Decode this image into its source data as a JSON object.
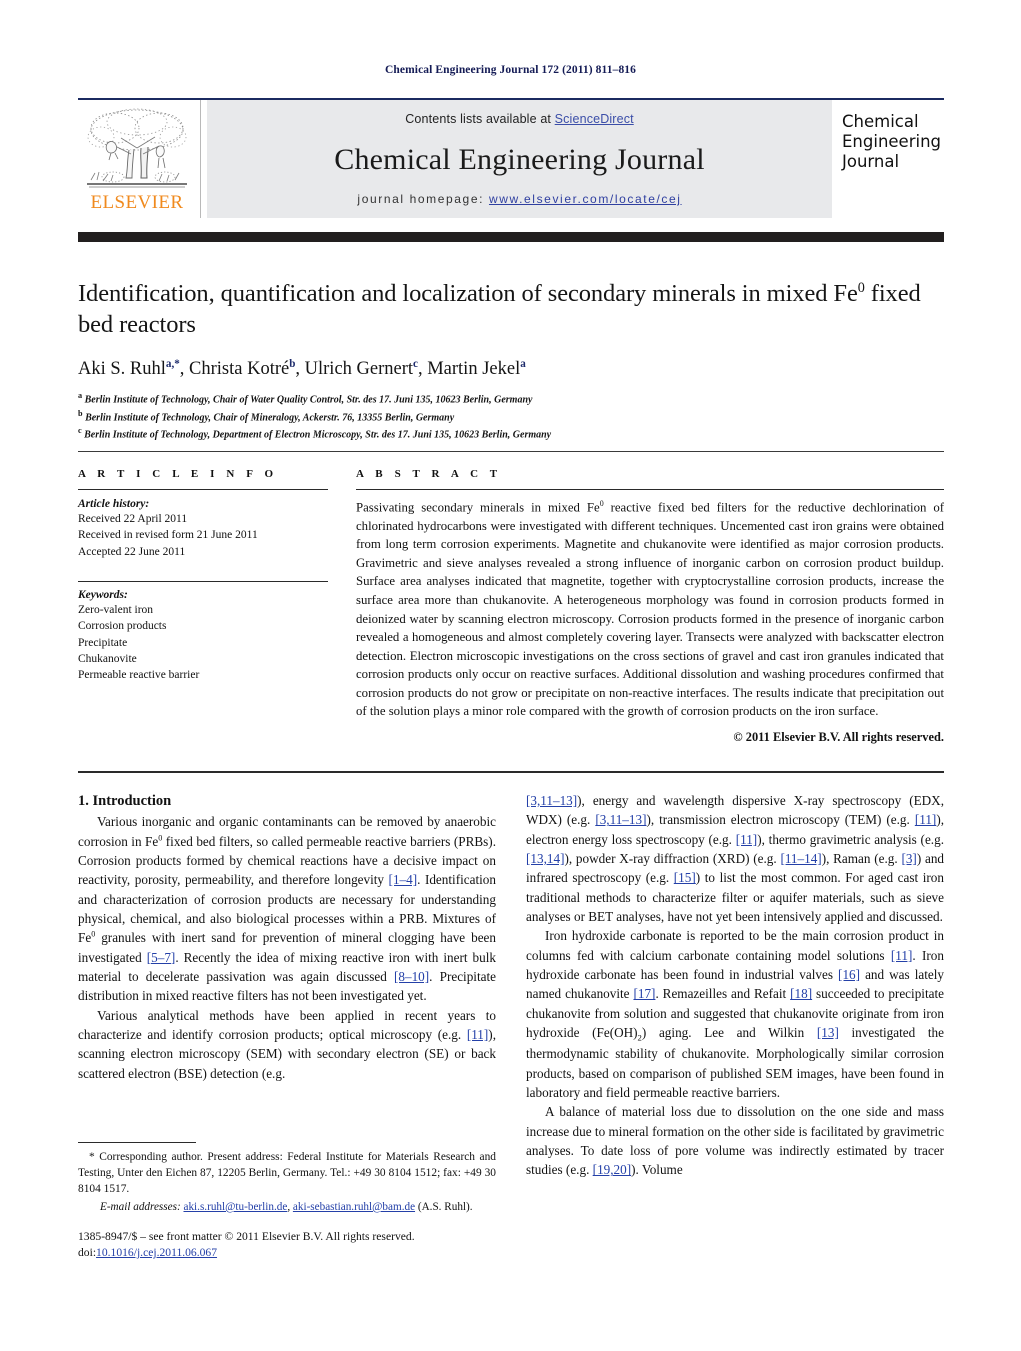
{
  "running_head": "Chemical Engineering Journal 172 (2011) 811–816",
  "masthead": {
    "contents_prefix": "Contents lists available at ",
    "sciencedirect": "ScienceDirect",
    "journal_title": "Chemical Engineering Journal",
    "homepage_label": "journal homepage: ",
    "homepage_url": "www.elsevier.com/locate/cej",
    "publisher_wordmark": "ELSEVIER",
    "cover_title": "Chemical Engineering Journal",
    "accent_orange": "#f08a1e",
    "link_blue": "#2f3fa0",
    "rule_navy": "#1b2a60"
  },
  "article": {
    "title_line1": "Identification, quantification and localization of secondary minerals in mixed Fe",
    "title_sup1": "0",
    "title_line2": "fixed bed reactors",
    "authors": [
      {
        "name": "Aki S. Ruhl",
        "marks": "a,*"
      },
      {
        "name": "Christa Kotré",
        "marks": "b"
      },
      {
        "name": "Ulrich Gernert",
        "marks": "c"
      },
      {
        "name": "Martin Jekel",
        "marks": "a"
      }
    ],
    "affiliations": [
      {
        "mark": "a",
        "text": "Berlin Institute of Technology, Chair of Water Quality Control, Str. des 17. Juni 135, 10623 Berlin, Germany"
      },
      {
        "mark": "b",
        "text": "Berlin Institute of Technology, Chair of Mineralogy, Ackerstr. 76, 13355 Berlin, Germany"
      },
      {
        "mark": "c",
        "text": "Berlin Institute of Technology, Department of Electron Microscopy, Str. des 17. Juni 135, 10623 Berlin, Germany"
      }
    ]
  },
  "article_info": {
    "heading": "A R T I C L E   I N F O",
    "history_label": "Article history:",
    "history": [
      "Received 22 April 2011",
      "Received in revised form 21 June 2011",
      "Accepted 22 June 2011"
    ],
    "keywords_label": "Keywords:",
    "keywords": [
      "Zero-valent iron",
      "Corrosion products",
      "Precipitate",
      "Chukanovite",
      "Permeable reactive barrier"
    ]
  },
  "abstract": {
    "heading": "A B S T R A C T",
    "part1": "Passivating secondary minerals in mixed Fe",
    "sup": "0",
    "part2": " reactive fixed bed filters for the reductive dechlorination of chlorinated hydrocarbons were investigated with different techniques. Uncemented cast iron grains were obtained from long term corrosion experiments. Magnetite and chukanovite were identified as major corrosion products. Gravimetric and sieve analyses revealed a strong influence of inorganic carbon on corrosion product buildup. Surface area analyses indicated that magnetite, together with cryptocrystalline corrosion products, increase the surface area more than chukanovite. A heterogeneous morphology was found in corrosion products formed in deionized water by scanning electron microscopy. Corrosion products formed in the presence of inorganic carbon revealed a homogeneous and almost completely covering layer. Transects were analyzed with backscatter electron detection. Electron microscopic investigations on the cross sections of gravel and cast iron granules indicated that corrosion products only occur on reactive surfaces. Additional dissolution and washing procedures confirmed that corrosion products do not grow or precipitate on non-reactive interfaces. The results indicate that precipitation out of the solution plays a minor role compared with the growth of corrosion products on the iron surface.",
    "copyright": "© 2011 Elsevier B.V. All rights reserved."
  },
  "introduction": {
    "heading": "1.  Introduction",
    "left": {
      "p1_a": "Various inorganic and organic contaminants can be removed by anaerobic corrosion in Fe",
      "p1_sup": "0",
      "p1_b": " fixed bed filters, so called permeable reactive barriers (PRBs). Corrosion products formed by chemical reactions have a decisive impact on reactivity, porosity, permeability, and therefore longevity ",
      "p1_ref1": "[1–4]",
      "p1_c": ". Identification and characterization of corrosion products are necessary for understanding physical, chemical, and also biological processes within a PRB. Mixtures of Fe",
      "p1_sup2": "0",
      "p1_d": " granules with inert sand for prevention of mineral clogging have been investigated ",
      "p1_ref2": "[5–7]",
      "p1_e": ". Recently the idea of mixing reactive iron with inert bulk material to decelerate passivation was again discussed ",
      "p1_ref3": "[8–10]",
      "p1_f": ". Precipitate distribution in mixed reactive filters has not been investigated yet.",
      "p2_a": "Various analytical methods have been applied in recent years to characterize and identify corrosion products; optical microscopy (e.g. ",
      "p2_ref1": "[11]",
      "p2_b": "), scanning electron microscopy (SEM) with secondary electron (SE) or back scattered electron (BSE) detection (e.g. "
    },
    "right": {
      "p2_ref2": "[3,11–13]",
      "p2_c": "), energy and wavelength dispersive X-ray spectroscopy (EDX, WDX) (e.g. ",
      "p2_ref3": "[3,11–13]",
      "p2_d": "), transmission electron microscopy (TEM) (e.g. ",
      "p2_ref4": "[11]",
      "p2_e": "), electron energy loss spectroscopy (e.g. ",
      "p2_ref5": "[11]",
      "p2_f": "), thermo gravimetric analysis (e.g. ",
      "p2_ref6": "[13,14]",
      "p2_g": "), powder X-ray diffraction (XRD) (e.g. ",
      "p2_ref7": "[11–14]",
      "p2_h": "), Raman (e.g. ",
      "p2_ref8": "[3]",
      "p2_i": ") and infrared spectroscopy (e.g. ",
      "p2_ref9": "[15]",
      "p2_j": ") to list the most common. For aged cast iron traditional methods to characterize filter or aquifer materials, such as sieve analyses or BET analyses, have not yet been intensively applied and discussed.",
      "p3_a": "Iron hydroxide carbonate is reported to be the main corrosion product in columns fed with calcium carbonate containing model solutions ",
      "p3_ref1": "[11]",
      "p3_b": ". Iron hydroxide carbonate has been found in industrial valves ",
      "p3_ref2": "[16]",
      "p3_c": " and was lately named chukanovite ",
      "p3_ref3": "[17]",
      "p3_d": ". Remazeilles and Refait ",
      "p3_ref4": "[18]",
      "p3_e": " succeeded to precipitate chukanovite from solution and suggested that chukanovite originate from iron hydroxide (Fe(OH)",
      "p3_sub": "2",
      "p3_f": ") aging. Lee and Wilkin ",
      "p3_ref5": "[13]",
      "p3_g": " investigated the thermodynamic stability of chukanovite. Morphologically similar corrosion products, based on comparison of published SEM images, have been found in laboratory and field permeable reactive barriers.",
      "p4_a": "A balance of material loss due to dissolution on the one side and mass increase due to mineral formation on the other side is facilitated by gravimetric analyses. To date loss of pore volume was indirectly estimated by tracer studies (e.g. ",
      "p4_ref1": "[19,20]",
      "p4_b": "). Volume"
    }
  },
  "footnote": {
    "corresponding": "* Corresponding author. Present address: Federal Institute for Materials Research and Testing, Unter den Eichen 87, 12205 Berlin, Germany. Tel.: +49 30 8104 1512; fax: +49 30 8104 1517.",
    "email_label": "E-mail addresses:",
    "email1": "aki.s.ruhl@tu-berlin.de",
    "email_sep": ", ",
    "email2": "aki-sebastian.ruhl@bam.de",
    "email_owner": " (A.S. Ruhl).",
    "issn_line": "1385-8947/$ – see front matter © 2011 Elsevier B.V. All rights reserved.",
    "doi_label": "doi:",
    "doi_value": "10.1016/j.cej.2011.06.067"
  }
}
